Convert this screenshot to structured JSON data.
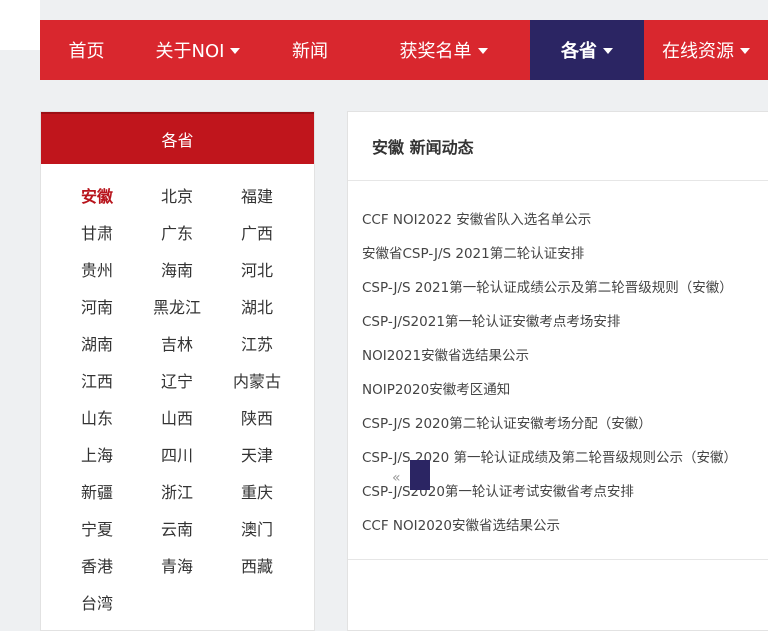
{
  "nav": {
    "items": [
      {
        "label": "首页",
        "dropdown": false
      },
      {
        "label": "关于NOI",
        "dropdown": true
      },
      {
        "label": "新闻",
        "dropdown": false
      },
      {
        "label": "获奖名单",
        "dropdown": true
      },
      {
        "label": "各省",
        "dropdown": true,
        "active": true
      },
      {
        "label": "在线资源",
        "dropdown": true
      }
    ]
  },
  "sidebar": {
    "title": "各省",
    "provinces": [
      "安徽",
      "北京",
      "福建",
      "甘肃",
      "广东",
      "广西",
      "贵州",
      "海南",
      "河北",
      "河南",
      "黑龙江",
      "湖北",
      "湖南",
      "吉林",
      "江苏",
      "江西",
      "辽宁",
      "内蒙古",
      "山东",
      "山西",
      "陕西",
      "上海",
      "四川",
      "天津",
      "新疆",
      "浙江",
      "重庆",
      "宁夏",
      "云南",
      "澳门",
      "香港",
      "青海",
      "西藏",
      "台湾"
    ],
    "active": "安徽"
  },
  "news": {
    "title": "安徽 新闻动态",
    "items": [
      "CCF NOI2022 安徽省队入选名单公示",
      "安徽省CSP-J/S 2021第二轮认证安排",
      "CSP-J/S 2021第一轮认证成绩公示及第二轮晋级规则（安徽）",
      "CSP-J/S2021第一轮认证安徽考点考场安排",
      "NOI2021安徽省选结果公示",
      "NOIP2020安徽考区通知",
      "CSP-J/S 2020第二轮认证安徽考场分配（安徽）",
      "CSP-J/S 2020 第一轮认证成绩及第二轮晋级规则公示（安徽）",
      "CSP-J/S2020第一轮认证考试安徽省考点安排",
      "CCF NOI2020安徽省选结果公示"
    ],
    "pager_prev": "«"
  },
  "colors": {
    "nav_bg": "#d9272e",
    "nav_active": "#2b2563",
    "sidebar_head": "#c0151c",
    "active_text": "#b8141c"
  }
}
